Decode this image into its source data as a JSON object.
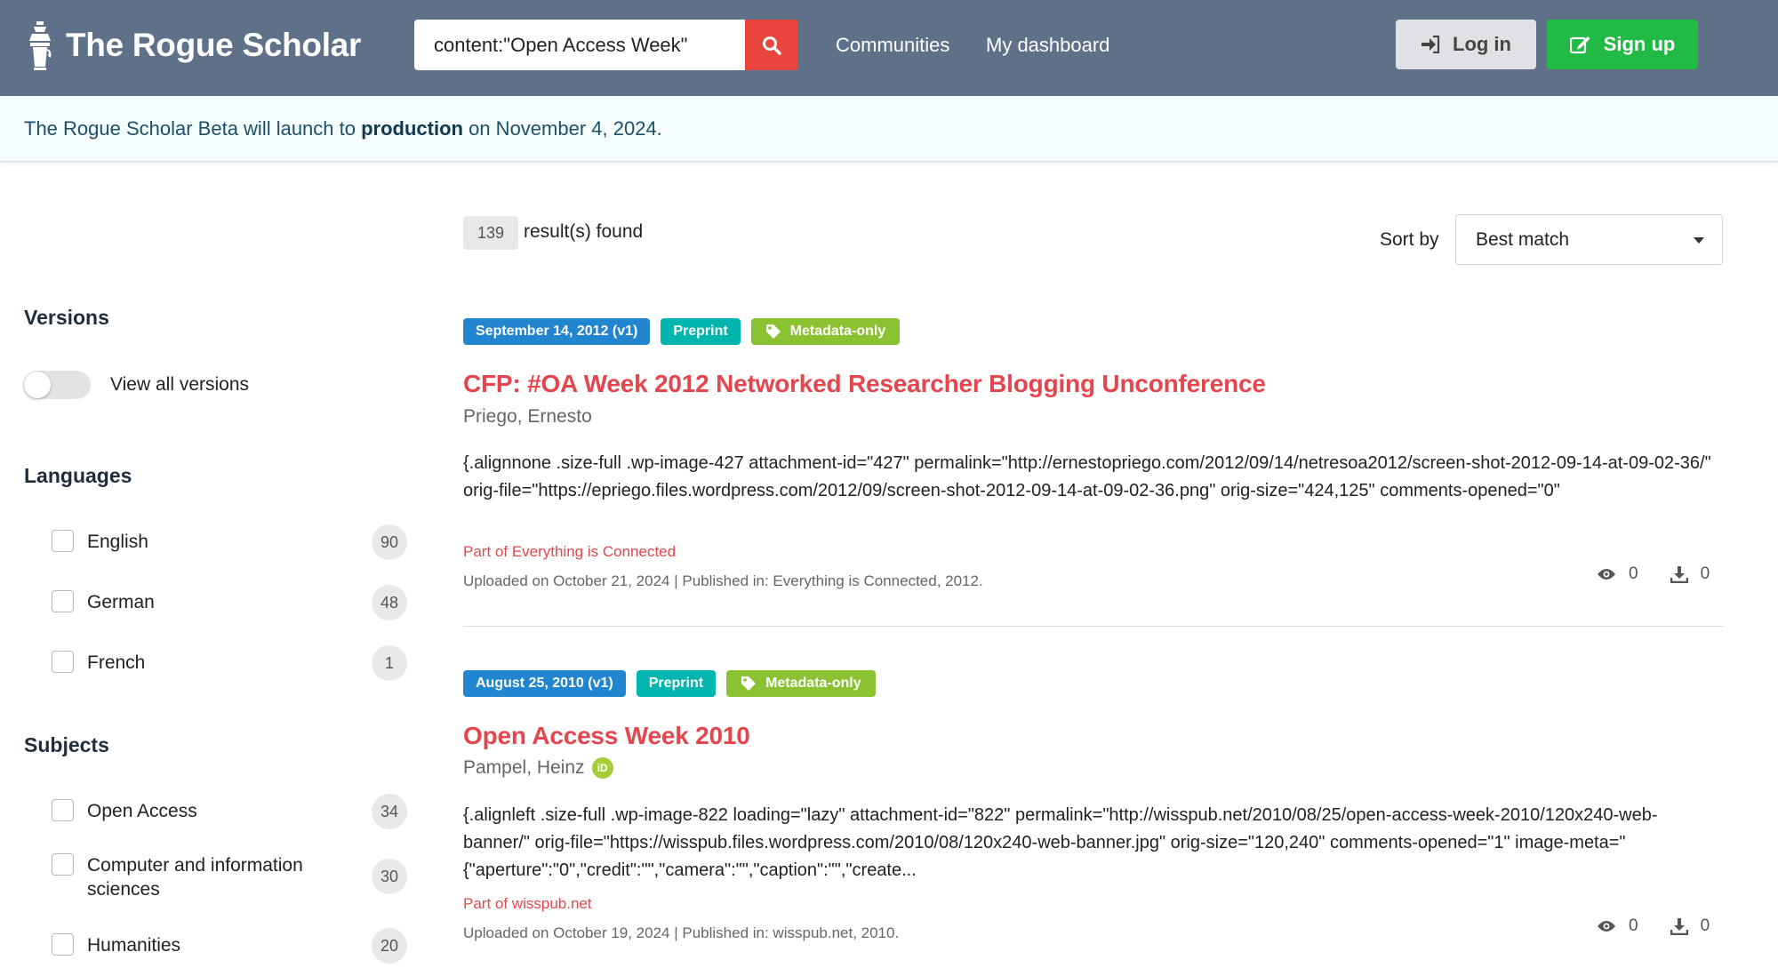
{
  "header": {
    "brand": "The Rogue Scholar",
    "search_value": "content:\"Open Access Week\"",
    "nav": [
      "Communities",
      "My dashboard"
    ],
    "login_label": "Log in",
    "signup_label": "Sign up"
  },
  "banner": {
    "prefix": "The Rogue Scholar Beta will launch to ",
    "highlight": "production",
    "suffix": " on November 4, 2024."
  },
  "sidebar": {
    "versions_heading": "Versions",
    "versions_toggle_label": "View all versions",
    "languages_heading": "Languages",
    "languages": [
      {
        "label": "English",
        "count": "90"
      },
      {
        "label": "German",
        "count": "48"
      },
      {
        "label": "French",
        "count": "1"
      }
    ],
    "subjects_heading": "Subjects",
    "subjects": [
      {
        "label": "Open Access",
        "count": "34"
      },
      {
        "label": "Computer and information sciences",
        "count": "30"
      },
      {
        "label": "Humanities",
        "count": "20"
      }
    ]
  },
  "results": {
    "count": "139",
    "count_text": "result(s) found",
    "sort_label": "Sort by",
    "sort_value": "Best match",
    "items": [
      {
        "date_label": "September 14, 2012 (v1)",
        "type_label": "Preprint",
        "access_label": "Metadata-only",
        "title": "CFP: #OA Week 2012 Networked Researcher Blogging Unconference",
        "author": "Priego, Ernesto",
        "description": "{.alignnone .size-full .wp-image-427 attachment-id=\"427\" permalink=\"http://ernestopriego.com/2012/09/14/netresoa2012/screen-shot-2012-09-14-at-09-02-36/\" orig-file=\"https://epriego.files.wordpress.com/2012/09/screen-shot-2012-09-14-at-09-02-36.png\" orig-size=\"424,125\" comments-opened=\"0\"",
        "part_prefix": "Part of ",
        "part_link": "Everything is Connected",
        "upload_info": "Uploaded on October 21, 2024 | Published in: Everything is Connected, 2012.",
        "views": "0",
        "downloads": "0"
      },
      {
        "date_label": "August 25, 2010 (v1)",
        "type_label": "Preprint",
        "access_label": "Metadata-only",
        "title": "Open Access Week 2010",
        "author": "Pampel, Heinz",
        "description": "{.alignleft .size-full .wp-image-822 loading=\"lazy\" attachment-id=\"822\" permalink=\"http://wisspub.net/2010/08/25/open-access-week-2010/120x240-web-banner/\" orig-file=\"https://wisspub.files.wordpress.com/2010/08/120x240-web-banner.jpg\" orig-size=\"120,240\" comments-opened=\"1\" image-meta=\"{\"aperture\":\"0\",\"credit\":\"\",\"camera\":\"\",\"caption\":\"\",\"create...",
        "part_prefix": "Part of ",
        "part_link": "wisspub.net",
        "upload_info": "Uploaded on October 19, 2024 | Published in: wisspub.net, 2010.",
        "views": "0",
        "downloads": "0"
      }
    ]
  },
  "icons": {
    "brand": "coffee-pot-icon",
    "search": "search-icon",
    "login": "sign-in-icon",
    "signup": "edit-icon",
    "tag": "tag-icon",
    "views": "eye-icon",
    "downloads": "download-icon",
    "orcid": "orcid-icon",
    "orcid_text": "iD"
  },
  "colors": {
    "header_bg": "#5f7189",
    "search_button": "#e8453c",
    "signup_button": "#21ba45",
    "title_red": "#e5464d",
    "date_label": "#2185d0",
    "type_label": "#00b5ad",
    "access_label": "#8bc232"
  }
}
